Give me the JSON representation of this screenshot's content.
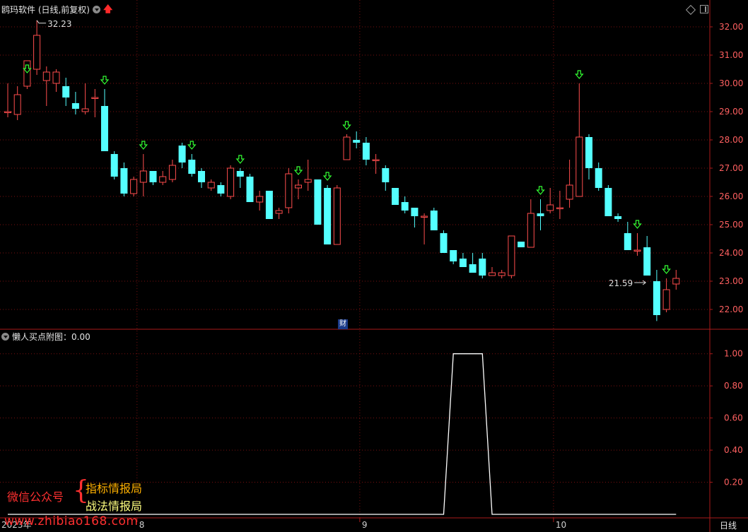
{
  "header": {
    "title": "鸥玛软件 (日线,前复权)",
    "sub_title": "懒人买点附图：0.00"
  },
  "badge": "财",
  "watermark": {
    "wechat": "微信公众号",
    "brace": "{",
    "line1": "指标情报局",
    "line2": "战法情报局",
    "url": "www.zhibiao168.com"
  },
  "period": "日线",
  "colors": {
    "up": "#ff4d4d",
    "down": "#54ffff",
    "grid": "#7a1010",
    "axis_text": "#ff6060",
    "signal": "#33ff33",
    "indicator": "#ffffff"
  },
  "chart_data": [
    {
      "type": "candlestick",
      "price_axis": {
        "min": 21.3,
        "max": 32.4,
        "ticks": [
          "32.00",
          "31.00",
          "30.00",
          "29.00",
          "28.00",
          "27.00",
          "26.00",
          "25.00",
          "24.00",
          "23.00",
          "22.00"
        ]
      },
      "date_labels": [
        {
          "label": "2023年",
          "index": 0
        },
        {
          "label": "8",
          "index": 14
        },
        {
          "label": "9",
          "index": 37
        },
        {
          "label": "10",
          "index": 57
        }
      ],
      "annotations": [
        {
          "text": "32.23",
          "index": 3
        },
        {
          "text": "21.59",
          "index": 66
        }
      ],
      "ohlc": [
        [
          29.0,
          30.0,
          28.8,
          29.0
        ],
        [
          28.9,
          29.9,
          28.7,
          29.6
        ],
        [
          29.9,
          30.2,
          29.8,
          30.8
        ],
        [
          30.5,
          32.23,
          30.3,
          31.7
        ],
        [
          30.1,
          30.6,
          29.2,
          30.4
        ],
        [
          30.0,
          30.5,
          29.7,
          30.4
        ],
        [
          29.9,
          30.2,
          29.2,
          29.5
        ],
        [
          29.3,
          29.7,
          28.9,
          29.1
        ],
        [
          29.0,
          30.0,
          28.9,
          29.1
        ],
        [
          29.5,
          29.8,
          28.8,
          29.5
        ],
        [
          29.2,
          29.8,
          27.6,
          27.6
        ],
        [
          27.5,
          27.6,
          26.6,
          26.7
        ],
        [
          27.0,
          27.2,
          26.0,
          26.1
        ],
        [
          26.1,
          26.7,
          26.0,
          26.6
        ],
        [
          26.5,
          27.5,
          26.0,
          26.9
        ],
        [
          26.9,
          26.9,
          26.4,
          26.5
        ],
        [
          26.5,
          26.9,
          26.4,
          26.7
        ],
        [
          26.6,
          27.3,
          26.5,
          27.1
        ],
        [
          27.8,
          27.9,
          27.0,
          27.2
        ],
        [
          27.3,
          27.5,
          26.7,
          26.8
        ],
        [
          26.9,
          27.0,
          26.3,
          26.5
        ],
        [
          26.3,
          26.6,
          26.2,
          26.5
        ],
        [
          26.4,
          26.5,
          26.0,
          26.1
        ],
        [
          26.0,
          27.1,
          25.9,
          27.0
        ],
        [
          26.9,
          27.0,
          26.3,
          26.7
        ],
        [
          26.7,
          26.8,
          25.8,
          25.8
        ],
        [
          25.8,
          26.2,
          25.5,
          26.0
        ],
        [
          26.2,
          26.2,
          25.2,
          25.2
        ],
        [
          25.4,
          25.6,
          25.2,
          25.5
        ],
        [
          25.6,
          27.0,
          25.4,
          26.8
        ],
        [
          26.3,
          26.6,
          25.9,
          26.4
        ],
        [
          26.5,
          27.3,
          26.2,
          26.6
        ],
        [
          26.6,
          26.6,
          25.0,
          25.0
        ],
        [
          26.3,
          26.4,
          24.3,
          24.3
        ],
        [
          24.3,
          26.4,
          24.3,
          26.3
        ],
        [
          27.3,
          28.2,
          27.3,
          28.1
        ],
        [
          28.0,
          28.3,
          27.7,
          27.9
        ],
        [
          27.9,
          28.1,
          27.1,
          27.3
        ],
        [
          27.3,
          27.5,
          26.8,
          27.3
        ],
        [
          27.0,
          27.1,
          26.2,
          26.5
        ],
        [
          26.3,
          26.3,
          25.7,
          25.7
        ],
        [
          25.8,
          26.0,
          25.4,
          25.5
        ],
        [
          25.6,
          25.5,
          24.9,
          25.3
        ],
        [
          25.3,
          25.4,
          24.3,
          25.3
        ],
        [
          25.5,
          25.6,
          24.8,
          24.8
        ],
        [
          24.7,
          24.8,
          24.0,
          24.0
        ],
        [
          24.1,
          24.1,
          23.6,
          23.7
        ],
        [
          23.8,
          24.0,
          23.5,
          23.5
        ],
        [
          23.6,
          24.0,
          23.3,
          23.3
        ],
        [
          23.8,
          24.0,
          23.1,
          23.2
        ],
        [
          23.2,
          23.5,
          23.2,
          23.3
        ],
        [
          23.2,
          23.4,
          23.1,
          23.3
        ],
        [
          23.2,
          24.6,
          23.1,
          24.6
        ],
        [
          24.4,
          24.4,
          24.2,
          24.2
        ],
        [
          24.2,
          25.9,
          24.2,
          25.4
        ],
        [
          25.4,
          25.9,
          24.8,
          25.3
        ],
        [
          25.5,
          26.3,
          25.4,
          25.7
        ],
        [
          25.6,
          26.2,
          25.2,
          25.6
        ],
        [
          25.9,
          27.3,
          25.6,
          26.4
        ],
        [
          26.0,
          30.0,
          26.0,
          28.1
        ],
        [
          28.1,
          28.2,
          26.6,
          27.0
        ],
        [
          27.0,
          27.2,
          26.2,
          26.3
        ],
        [
          26.3,
          26.4,
          25.3,
          25.3
        ],
        [
          25.3,
          25.4,
          25.1,
          25.2
        ],
        [
          24.7,
          25.1,
          24.3,
          24.1
        ],
        [
          24.1,
          24.7,
          23.9,
          24.1
        ],
        [
          24.2,
          24.6,
          23.2,
          23.2
        ],
        [
          23.0,
          23.4,
          21.59,
          21.8
        ],
        [
          22.0,
          23.1,
          21.9,
          22.7
        ],
        [
          22.9,
          23.4,
          22.7,
          23.1
        ]
      ],
      "buy_signals": [
        2,
        10,
        14,
        19,
        24,
        30,
        33,
        35,
        55,
        59,
        65,
        68
      ]
    },
    {
      "type": "line",
      "name": "懒人买点附图",
      "y_axis": {
        "min": 0,
        "max": 1.1,
        "ticks": [
          "1.00",
          "0.80",
          "0.60",
          "0.40",
          "0.20"
        ]
      },
      "values": [
        0,
        0,
        0,
        0,
        0,
        0,
        0,
        0,
        0,
        0,
        0,
        0,
        0,
        0,
        0,
        0,
        0,
        0,
        0,
        0,
        0,
        0,
        0,
        0,
        0,
        0,
        0,
        0,
        0,
        0,
        0,
        0,
        0,
        0,
        0,
        0,
        0,
        0,
        0,
        0,
        0,
        0,
        0,
        0,
        0,
        0,
        1,
        1,
        1,
        1,
        0,
        0,
        0,
        0,
        0,
        0,
        0,
        0,
        0,
        0,
        0,
        0,
        0,
        0,
        0,
        0,
        0,
        0,
        0,
        0
      ]
    }
  ]
}
